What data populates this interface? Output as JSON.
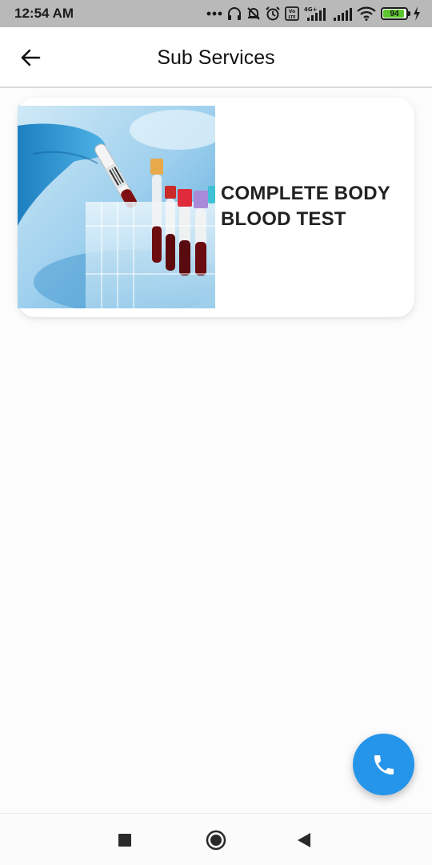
{
  "status_bar": {
    "time": "12:54 AM",
    "network_label": "4G+",
    "volte_label": "Vo LTE",
    "battery_level": "94",
    "battery_percent": 94,
    "icons": [
      "more-dots-icon",
      "headset-icon",
      "silent-bell-icon",
      "alarm-icon",
      "volte-icon",
      "signal-4g-icon",
      "signal-icon",
      "wifi-icon",
      "battery-icon",
      "charging-icon"
    ]
  },
  "app_bar": {
    "title": "Sub Services",
    "back_icon": "arrow-left-icon"
  },
  "services": [
    {
      "title": "COMPLETE BODY BLOOD TEST",
      "image": "blood-test-tubes-photo"
    }
  ],
  "fab": {
    "icon": "phone-icon",
    "color": "#2595ea"
  },
  "nav_bar": {
    "icons": [
      "recents-square-icon",
      "home-circle-icon",
      "back-triangle-icon"
    ]
  },
  "colors": {
    "accent": "#2595ea",
    "battery": "#5bc62f"
  }
}
